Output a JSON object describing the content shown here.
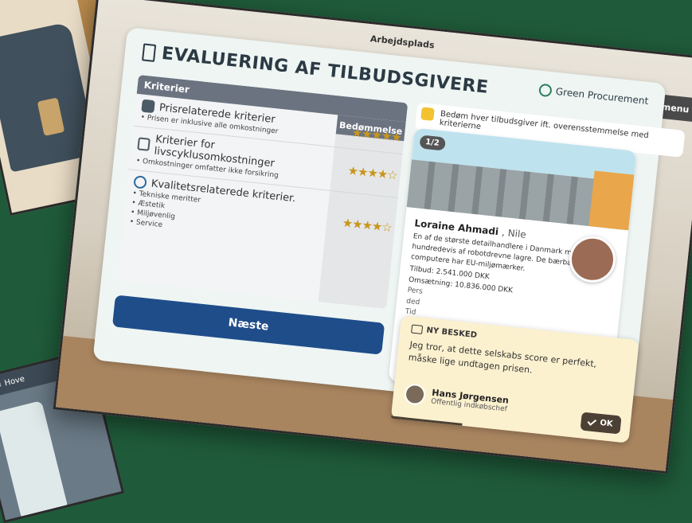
{
  "background": {
    "top_left_thumbnail": "bag-scene",
    "bottom_left_thumbnail": {
      "menu_label": "Hove"
    }
  },
  "screen": {
    "location_label": "Arbejdsplads",
    "menu_button_label": "Hovedmenu",
    "title": "EVALUERING AF TILBUDSGIVERE",
    "badge_label": "Green Procurement",
    "hint_text": "Bedøm hver tilbudsgiver ift. overensstemmelse med kriterierne",
    "criteria": {
      "header": "Kriterier",
      "rating_header": "Bedømmelse",
      "rows": [
        {
          "icon": "money-bag-icon",
          "title": "Prisrelaterede kriterier",
          "details": [
            "• Prisen er inklusive alle omkostninger"
          ],
          "rating": 5,
          "stars": "☆☆☆☆☆"
        },
        {
          "icon": "thumbs-up-icon",
          "title": "Kriterier for livscyklusomkostninger",
          "details": [
            "• Omkostninger omfatter ikke forsikring"
          ],
          "rating": 4,
          "stars": "☆☆☆☆☆"
        },
        {
          "icon": "check-circle-icon",
          "title": "Kvalitetsrelaterede kriterier.",
          "details": [
            "• Tekniske meritter",
            "• Æstetik",
            "• Miljøvenlig",
            "• Service"
          ],
          "rating": 4,
          "stars": "☆☆☆☆☆"
        }
      ]
    },
    "next_button_label": "Næste",
    "card": {
      "pager": "1/2",
      "name": "Loraine Ahmadi",
      "company": ", Nile",
      "description": "En af de største detailhandlere i Danmark med hundredevis af robotdrevne lagre. De bærbare computere har EU-miljømærker.",
      "offer": "Tilbud: 2.541.000 DKK",
      "revenue": "Omsætning: 10.836.000 DKK",
      "clipped_1": "Pers",
      "clipped_2": "ded",
      "clipped_3": "Tid"
    },
    "message": {
      "header": "NY BESKED",
      "text": "Jeg tror, at dette selskabs score er perfekt, måske lige undtagen prisen.",
      "sender_name": "Hans Jørgensen",
      "sender_role": "Offentlig indkøbschef",
      "ok_label": "OK",
      "progress": 0.3
    }
  },
  "colors": {
    "background": "#1f5b3a",
    "primary_button": "#1f4d8a",
    "star": "#c9961a",
    "message_bg": "#fcf1cf"
  }
}
